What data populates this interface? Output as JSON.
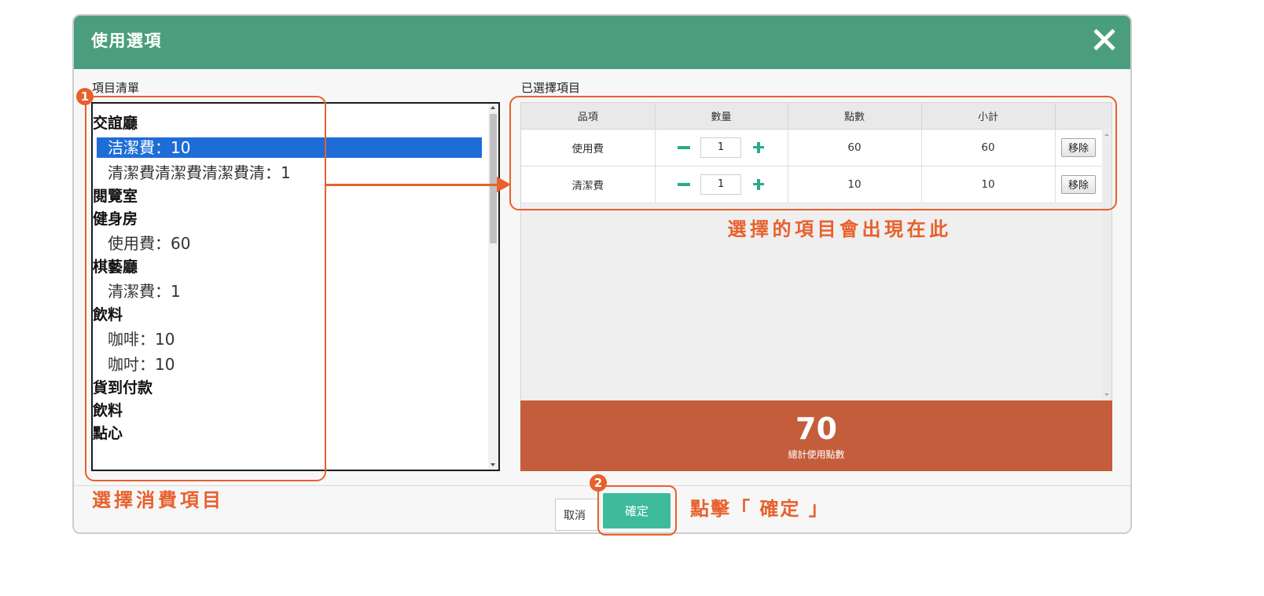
{
  "dialog": {
    "title": "使用選項",
    "close_icon": "close-icon"
  },
  "item_list": {
    "label": "項目清單",
    "groups": [
      {
        "name": "交誼廳",
        "items": [
          {
            "label": "洁潔費：10",
            "selected": true
          },
          {
            "label": "清潔費清潔費清潔費清：1",
            "selected": false
          }
        ]
      },
      {
        "name": "閱覽室",
        "items": []
      },
      {
        "name": "健身房",
        "items": [
          {
            "label": "使用費：60",
            "selected": false
          }
        ]
      },
      {
        "name": "棋藝廳",
        "items": [
          {
            "label": "清潔費：1",
            "selected": false
          }
        ]
      },
      {
        "name": "飲料",
        "items": [
          {
            "label": "咖啡：10",
            "selected": false
          },
          {
            "label": "咖吋：10",
            "selected": false
          }
        ]
      },
      {
        "name": "貨到付款",
        "items": []
      },
      {
        "name": "飲料",
        "items": []
      },
      {
        "name": "點心",
        "items": []
      }
    ]
  },
  "selected_items": {
    "label": "已選擇項目",
    "columns": [
      "品項",
      "數量",
      "點數",
      "小計",
      ""
    ],
    "rows": [
      {
        "item": "使用費",
        "quantity": "1",
        "points": "60",
        "subtotal": "60",
        "remove_label": "移除"
      },
      {
        "item": "清潔費",
        "quantity": "1",
        "points": "10",
        "subtotal": "10",
        "remove_label": "移除"
      }
    ],
    "decrease_icon": "minus-icon",
    "increase_icon": "plus-icon",
    "total": {
      "value": "70",
      "label": "總計使用點數"
    }
  },
  "footer": {
    "cancel_label": "取消",
    "confirm_label": "確定"
  },
  "annotations": {
    "step1": {
      "badge": "1",
      "text": "選擇消費項目"
    },
    "step2": {
      "badge": "2",
      "text": "點擊「 確定 」"
    },
    "selected_note": "選擇的項目會出現在此",
    "arrow_icon": "arrow-right-icon"
  },
  "colors": {
    "header": "#4b9e7d",
    "annotation": "#e8602c",
    "confirm_button": "#3dbb9c",
    "stepper": "#2aaa8c",
    "selection": "#1e6dd6",
    "total_panel": "#c45d3b"
  }
}
